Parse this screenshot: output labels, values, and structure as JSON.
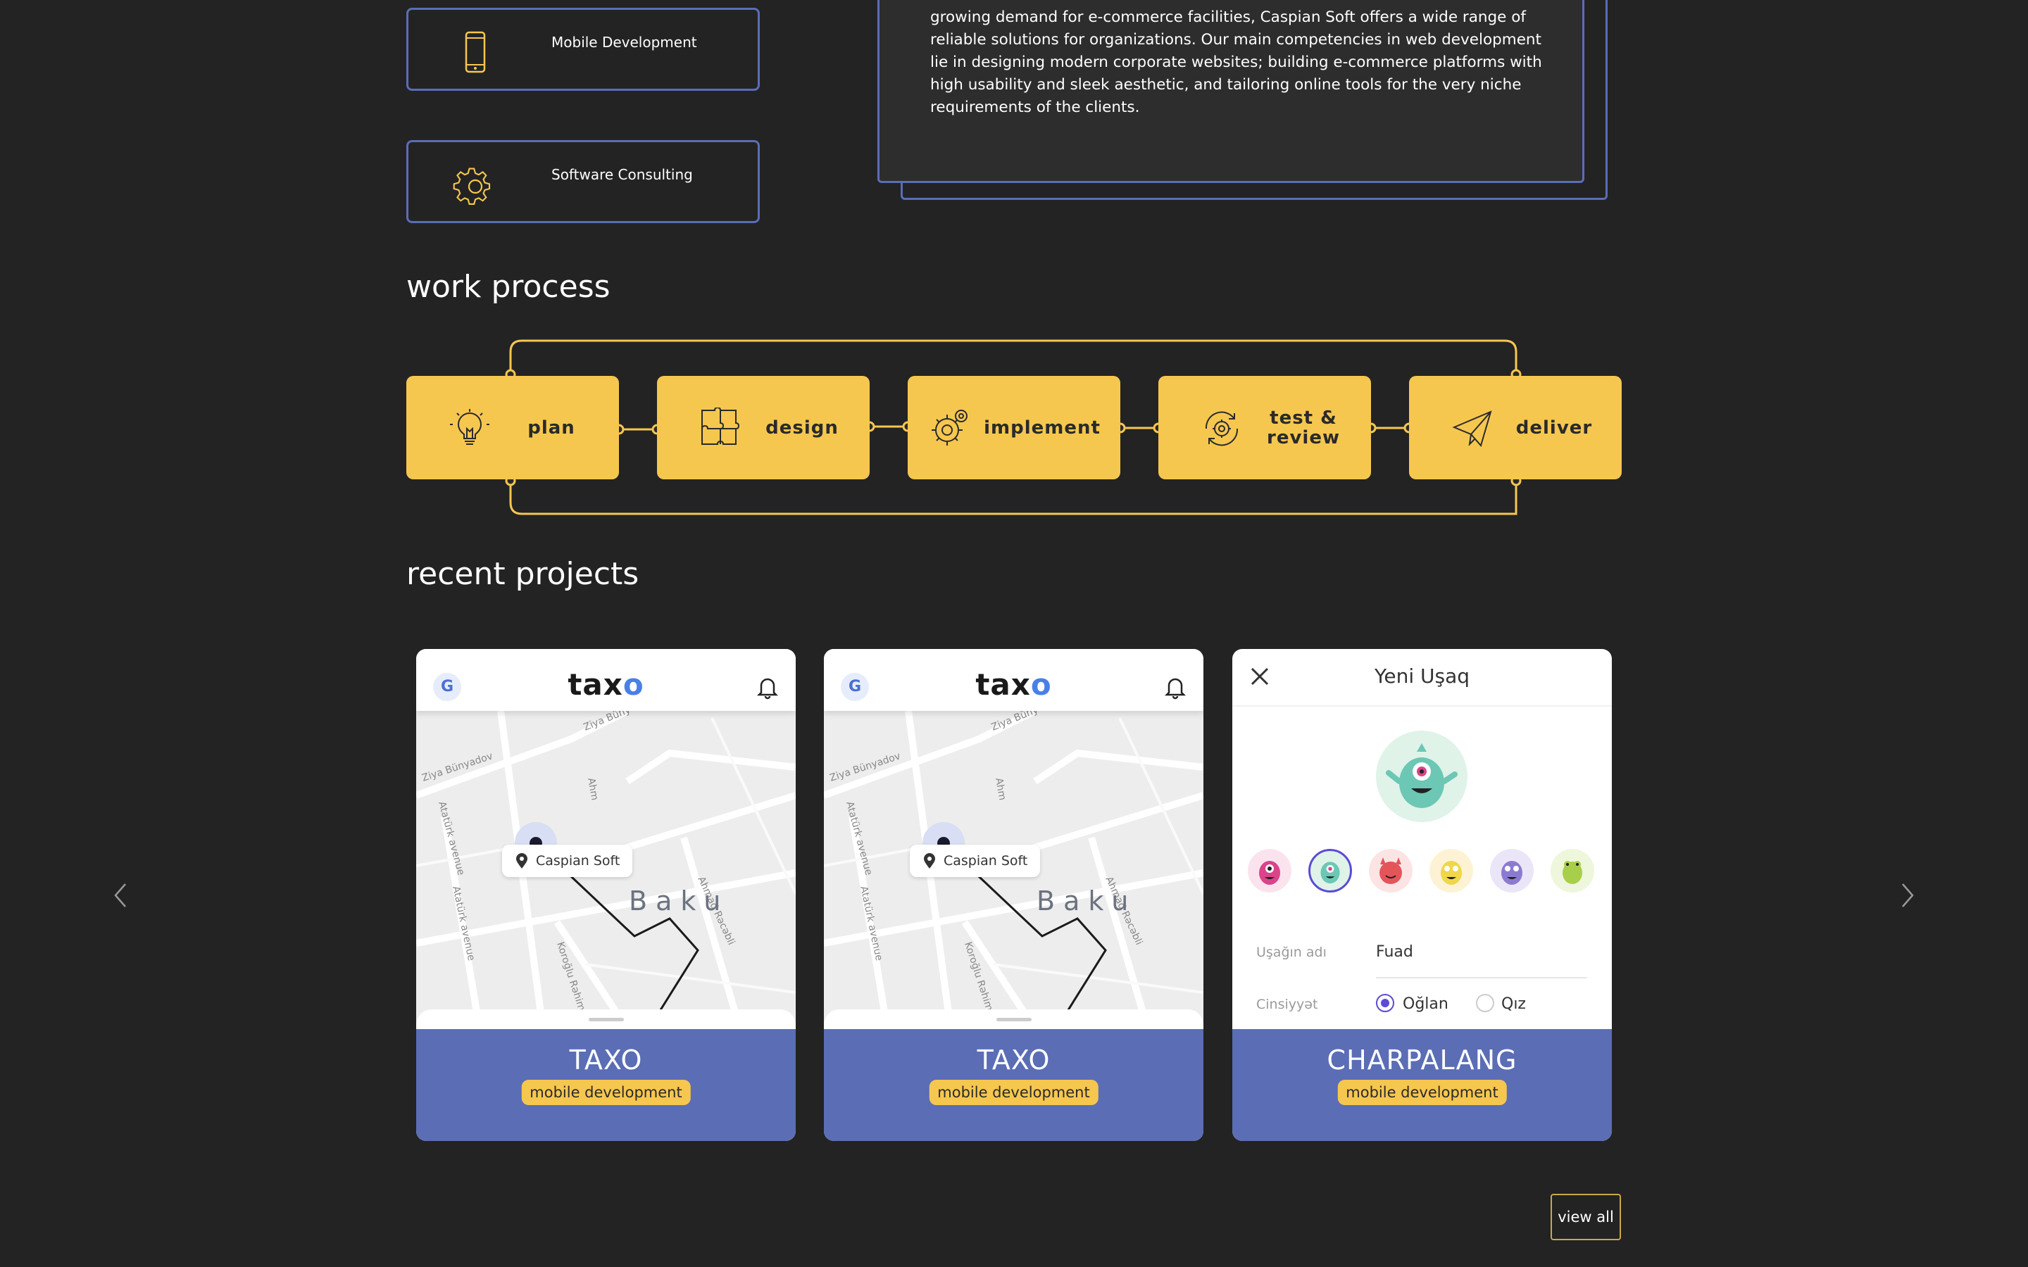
{
  "services": [
    {
      "label": "Mobile Development",
      "icon": "smartphone-icon"
    },
    {
      "label": "Software Consulting",
      "icon": "gear-icon"
    }
  ],
  "about_text": "growing demand for e-commerce facilities, Caspian Soft offers a wide range of reliable solutions for organizations. Our main competencies in web development lie in designing modern corporate websites; building e-commerce platforms with high usability and sleek aesthetic, and tailoring online tools for the very niche requirements of the clients.",
  "work_process": {
    "title": "work process",
    "steps": [
      {
        "label": "plan",
        "icon": "lightbulb-icon"
      },
      {
        "label": "design",
        "icon": "puzzle-icon"
      },
      {
        "label": "implement",
        "icon": "gears-icon"
      },
      {
        "label": "test & review",
        "icon": "refresh-gear-icon"
      },
      {
        "label": "deliver",
        "icon": "paper-plane-icon"
      }
    ]
  },
  "recent_projects": {
    "title": "recent projects",
    "view_all_label": "view all",
    "cards": [
      {
        "name": "TAXO",
        "tag": "mobile development",
        "screen": {
          "logo": "taxo",
          "avatar_letter": "G",
          "pin_label": "Caspian Soft",
          "city": "Baku",
          "streets": [
            "Ziya Bünyadov",
            "Atatürk avenue",
            "Atatürk avenue",
            "Ahmad Rəcəbli",
            "Koroğlu Rəhimov",
            "Ziya Büny"
          ]
        }
      },
      {
        "name": "TAXO",
        "tag": "mobile development",
        "screen": {
          "logo": "taxo",
          "avatar_letter": "G",
          "pin_label": "Caspian Soft",
          "city": "Baku",
          "streets": [
            "Ziya Bünyadov",
            "Atatürk avenue",
            "Atatürk avenue",
            "Ahmad Rəcəbli",
            "Koroğlu Rəhimov",
            "Ziya Büny"
          ]
        }
      },
      {
        "name": "CHARPALANG",
        "tag": "mobile development",
        "screen": {
          "title": "Yeni Uşaq",
          "name_label": "Uşağın adı",
          "name_value": "Fuad",
          "gender_label": "Cinsiyyət",
          "option_boy": "Oğlan",
          "option_girl": "Qız"
        }
      }
    ]
  },
  "colors": {
    "accent_yellow": "#f6c74f",
    "accent_blue": "#5b6db5",
    "background": "#232323"
  }
}
